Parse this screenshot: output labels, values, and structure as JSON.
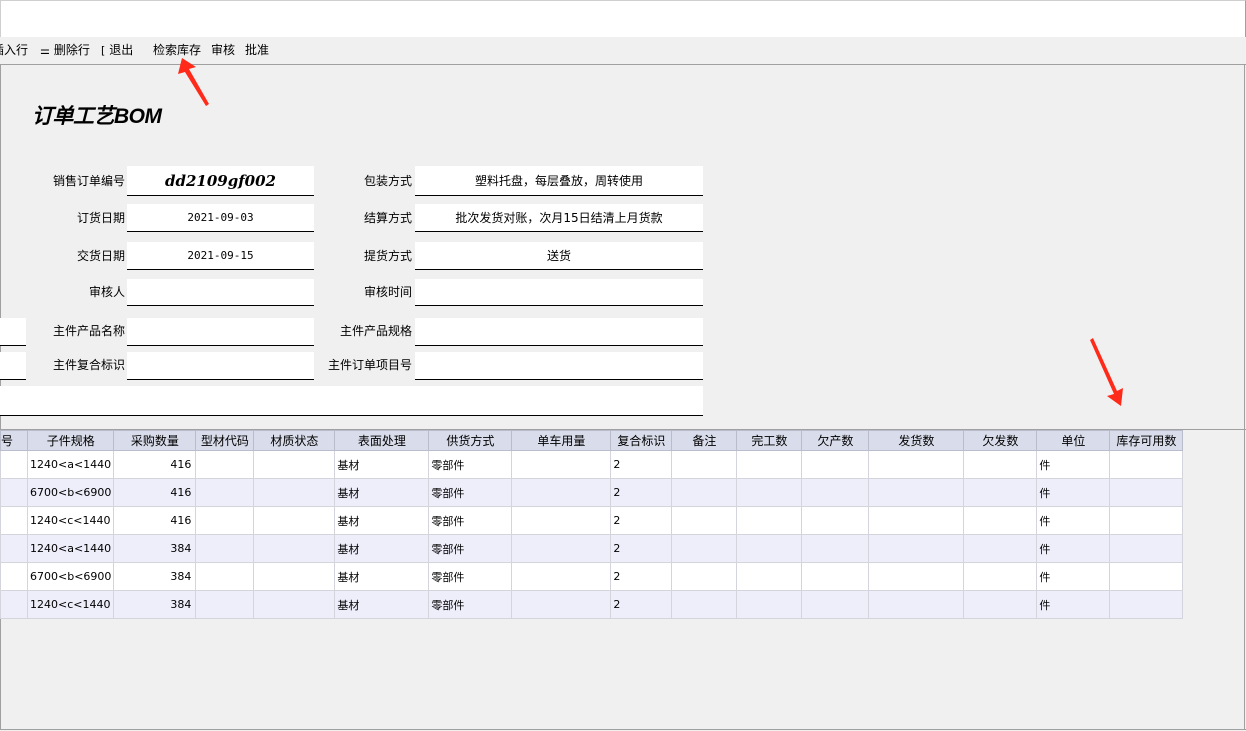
{
  "toolbar": {
    "insert_row": "插入行",
    "delete_row": "删除行",
    "exit": "退出",
    "search_stock": "检索库存",
    "review": "审核",
    "approve": "批准"
  },
  "form": {
    "title": "订单工艺BOM",
    "order_no_label": "销售订单编号",
    "order_no": "dd2109gf002",
    "order_date_label": "订货日期",
    "order_date": "2021-09-03",
    "delivery_date_label": "交货日期",
    "delivery_date": "2021-09-15",
    "reviewer_label": "审核人",
    "reviewer": "",
    "main_product_name_label": "主件产品名称",
    "main_product_name": "",
    "main_composite_label": "主件复合标识",
    "main_composite": "",
    "packing_label": "包装方式",
    "packing": "塑料托盘，每层叠放，周转使用",
    "settlement_label": "结算方式",
    "settlement": "批次发货对账，次月15日结清上月货款",
    "pickup_label": "提货方式",
    "pickup": "送货",
    "review_time_label": "审核时间",
    "review_time": "",
    "main_spec_label": "主件产品规格",
    "main_spec": "",
    "main_item_no_label": "主件订单项目号",
    "main_item_no": ""
  },
  "grid": {
    "columns": [
      "号",
      "子件规格",
      "采购数量",
      "型材代码",
      "材质状态",
      "表面处理",
      "供货方式",
      "单车用量",
      "复合标识",
      "备注",
      "完工数",
      "欠产数",
      "发货数",
      "欠发数",
      "单位",
      "库存可用数"
    ],
    "rows": [
      [
        "",
        "1240<a<1440",
        "416",
        "",
        "",
        "基材",
        "零部件",
        "",
        "2",
        "",
        "",
        "",
        "",
        "",
        "件",
        ""
      ],
      [
        "",
        "6700<b<6900",
        "416",
        "",
        "",
        "基材",
        "零部件",
        "",
        "2",
        "",
        "",
        "",
        "",
        "",
        "件",
        ""
      ],
      [
        "",
        "1240<c<1440",
        "416",
        "",
        "",
        "基材",
        "零部件",
        "",
        "2",
        "",
        "",
        "",
        "",
        "",
        "件",
        ""
      ],
      [
        "",
        "1240<a<1440",
        "384",
        "",
        "",
        "基材",
        "零部件",
        "",
        "2",
        "",
        "",
        "",
        "",
        "",
        "件",
        ""
      ],
      [
        "",
        "6700<b<6900",
        "384",
        "",
        "",
        "基材",
        "零部件",
        "",
        "2",
        "",
        "",
        "",
        "",
        "",
        "件",
        ""
      ],
      [
        "",
        "1240<c<1440",
        "384",
        "",
        "",
        "基材",
        "零部件",
        "",
        "2",
        "",
        "",
        "",
        "",
        "",
        "件",
        ""
      ]
    ]
  },
  "colors": {
    "arrow": "#ff2a1a",
    "header_bg": "#d9dcea",
    "alt_row_bg": "#eeeefb"
  }
}
